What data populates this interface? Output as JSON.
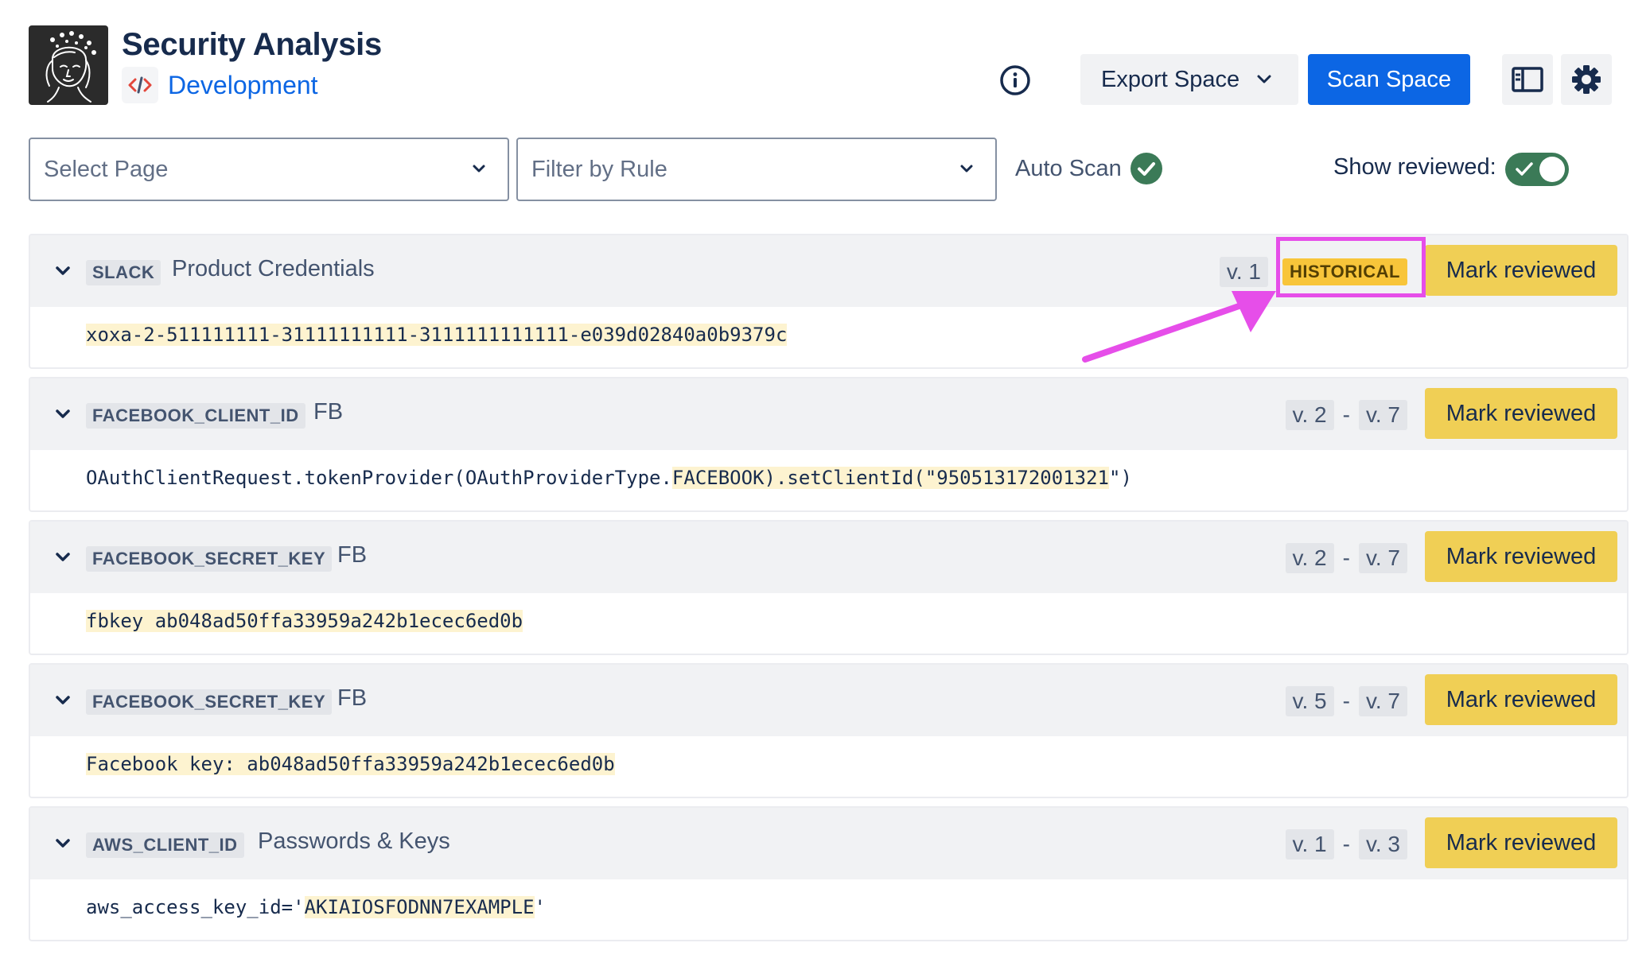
{
  "header": {
    "title": "Security Analysis",
    "space_name": "Development",
    "export_label": "Export Space",
    "scan_label": "Scan Space"
  },
  "filters": {
    "select_page_placeholder": "Select Page",
    "filter_rule_placeholder": "Filter by Rule",
    "auto_scan_label": "Auto Scan",
    "auto_scan_enabled": true,
    "show_reviewed_label": "Show reviewed:",
    "show_reviewed_on": true
  },
  "findings": [
    {
      "rule": "SLACK",
      "name": "Product Credentials",
      "versions": [
        "v. 1"
      ],
      "status_badge": "HISTORICAL",
      "action": "Mark reviewed",
      "code": {
        "before": "",
        "secret": "xoxa-2-511111111-31111111111-3111111111111-e039d02840a0b9379c",
        "after": ""
      }
    },
    {
      "rule": "FACEBOOK_CLIENT_ID",
      "name": "FB",
      "versions": [
        "v. 2",
        "v. 7"
      ],
      "action": "Mark reviewed",
      "code": {
        "before": "OAuthClientRequest.tokenProvider(OAuthProviderType.",
        "secret": "FACEBOOK).setClientId(\"950513172001321",
        "after": "\")"
      }
    },
    {
      "rule": "FACEBOOK_SECRET_KEY",
      "name": "FB",
      "versions": [
        "v. 2",
        "v. 7"
      ],
      "action": "Mark reviewed",
      "code": {
        "before": "",
        "secret": "fbkey ab048ad50ffa33959a242b1ecec6ed0b",
        "after": ""
      }
    },
    {
      "rule": "FACEBOOK_SECRET_KEY",
      "name": "FB",
      "versions": [
        "v. 5",
        "v. 7"
      ],
      "action": "Mark reviewed",
      "code": {
        "before": "",
        "secret": "Facebook key: ab048ad50ffa33959a242b1ecec6ed0b",
        "after": ""
      }
    },
    {
      "rule": "AWS_CLIENT_ID",
      "name": "Passwords & Keys",
      "versions": [
        "v. 1",
        "v. 3"
      ],
      "action": "Mark reviewed",
      "code": {
        "before": "aws_access_key_id='",
        "secret": "AKIAIOSFODNN7EXAMPLE",
        "after": "'"
      }
    }
  ],
  "icons": {
    "logo": "woman-portrait-logo",
    "space": "code-icon",
    "info": "info-icon",
    "export_dropdown": "chevron-down-icon",
    "layout": "panel-layout-icon",
    "settings": "gear-icon",
    "finding_toggle": "chevron-down-icon",
    "auto_scan_status": "check-circle-icon"
  },
  "colors": {
    "primary": "#0c66e4",
    "mark_reviewed": "#f0cf55",
    "historical_badge": "#f8c53a",
    "success": "#3b7a57",
    "annotation": "#e64ee9",
    "secret_highlight": "#fdf3d0"
  }
}
